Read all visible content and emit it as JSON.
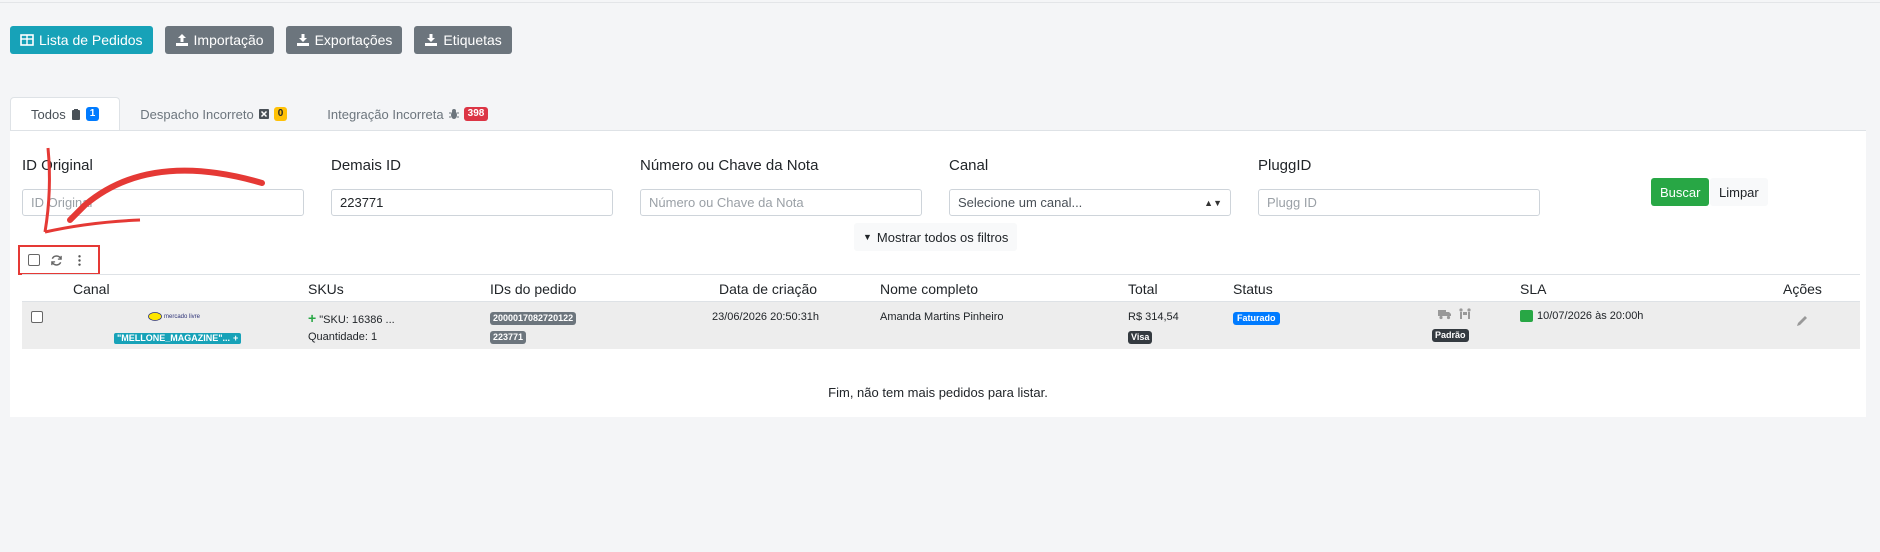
{
  "toolbar": {
    "buttons": [
      {
        "label": "Lista de Pedidos",
        "icon": "table-icon",
        "color": "#17a2b8"
      },
      {
        "label": "Importação",
        "icon": "upload-icon",
        "color": "#6c757d"
      },
      {
        "label": "Exportações",
        "icon": "download-icon",
        "color": "#6c757d"
      },
      {
        "label": "Etiquetas",
        "icon": "download-icon",
        "color": "#6c757d"
      }
    ]
  },
  "tabs": [
    {
      "label": "Todos",
      "badge": "1",
      "icon": "clipboard-icon",
      "active": true
    },
    {
      "label": "Despacho Incorreto",
      "badge": "0",
      "icon": "close-box-icon",
      "active": false
    },
    {
      "label": "Integração Incorreta",
      "badge": "398",
      "icon": "bug-icon",
      "active": false
    }
  ],
  "filters": {
    "id_original": {
      "label": "ID Original",
      "placeholder": "ID Original"
    },
    "demais_id": {
      "label": "Demais ID",
      "value": "223771"
    },
    "numero_nota": {
      "label": "Número ou Chave da Nota",
      "placeholder": "Número ou Chave da Nota"
    },
    "canal": {
      "label": "Canal",
      "value": "Selecione um canal..."
    },
    "pluggid": {
      "label": "PluggID",
      "placeholder": "Plugg ID"
    },
    "search_label": "Buscar",
    "clear_label": "Limpar",
    "more_filters_label": "Mostrar todos os filtros"
  },
  "table": {
    "headers": {
      "canal": "Canal",
      "skus": "SKUs",
      "ids": "IDs do pedido",
      "data": "Data de criação",
      "nome": "Nome completo",
      "total": "Total",
      "status": "Status",
      "sla": "SLA",
      "acoes": "Ações"
    },
    "rows": [
      {
        "channel_logo": "mercado livre",
        "channel_store": "\"MELLONE_MAGAZINE\"...",
        "sku": "\"SKU: 16386 ...",
        "quantity": "Quantidade: 1",
        "order_id_1": "2000017082720122",
        "order_id_2": "223771",
        "created": "23/06/2026 20:50:31h",
        "name": "Amanda Martins Pinheiro",
        "total": "R$ 314,54",
        "payment": "Visa",
        "status": "Faturado",
        "shipping_type": "Padrão",
        "sla": "10/07/2026 às 20:00h"
      }
    ],
    "end_message": "Fim, não tem mais pedidos para listar."
  },
  "colors": {
    "accent": "#17a2b8",
    "success": "#28a745",
    "danger": "#dc3545",
    "annotation": "#e53935"
  }
}
